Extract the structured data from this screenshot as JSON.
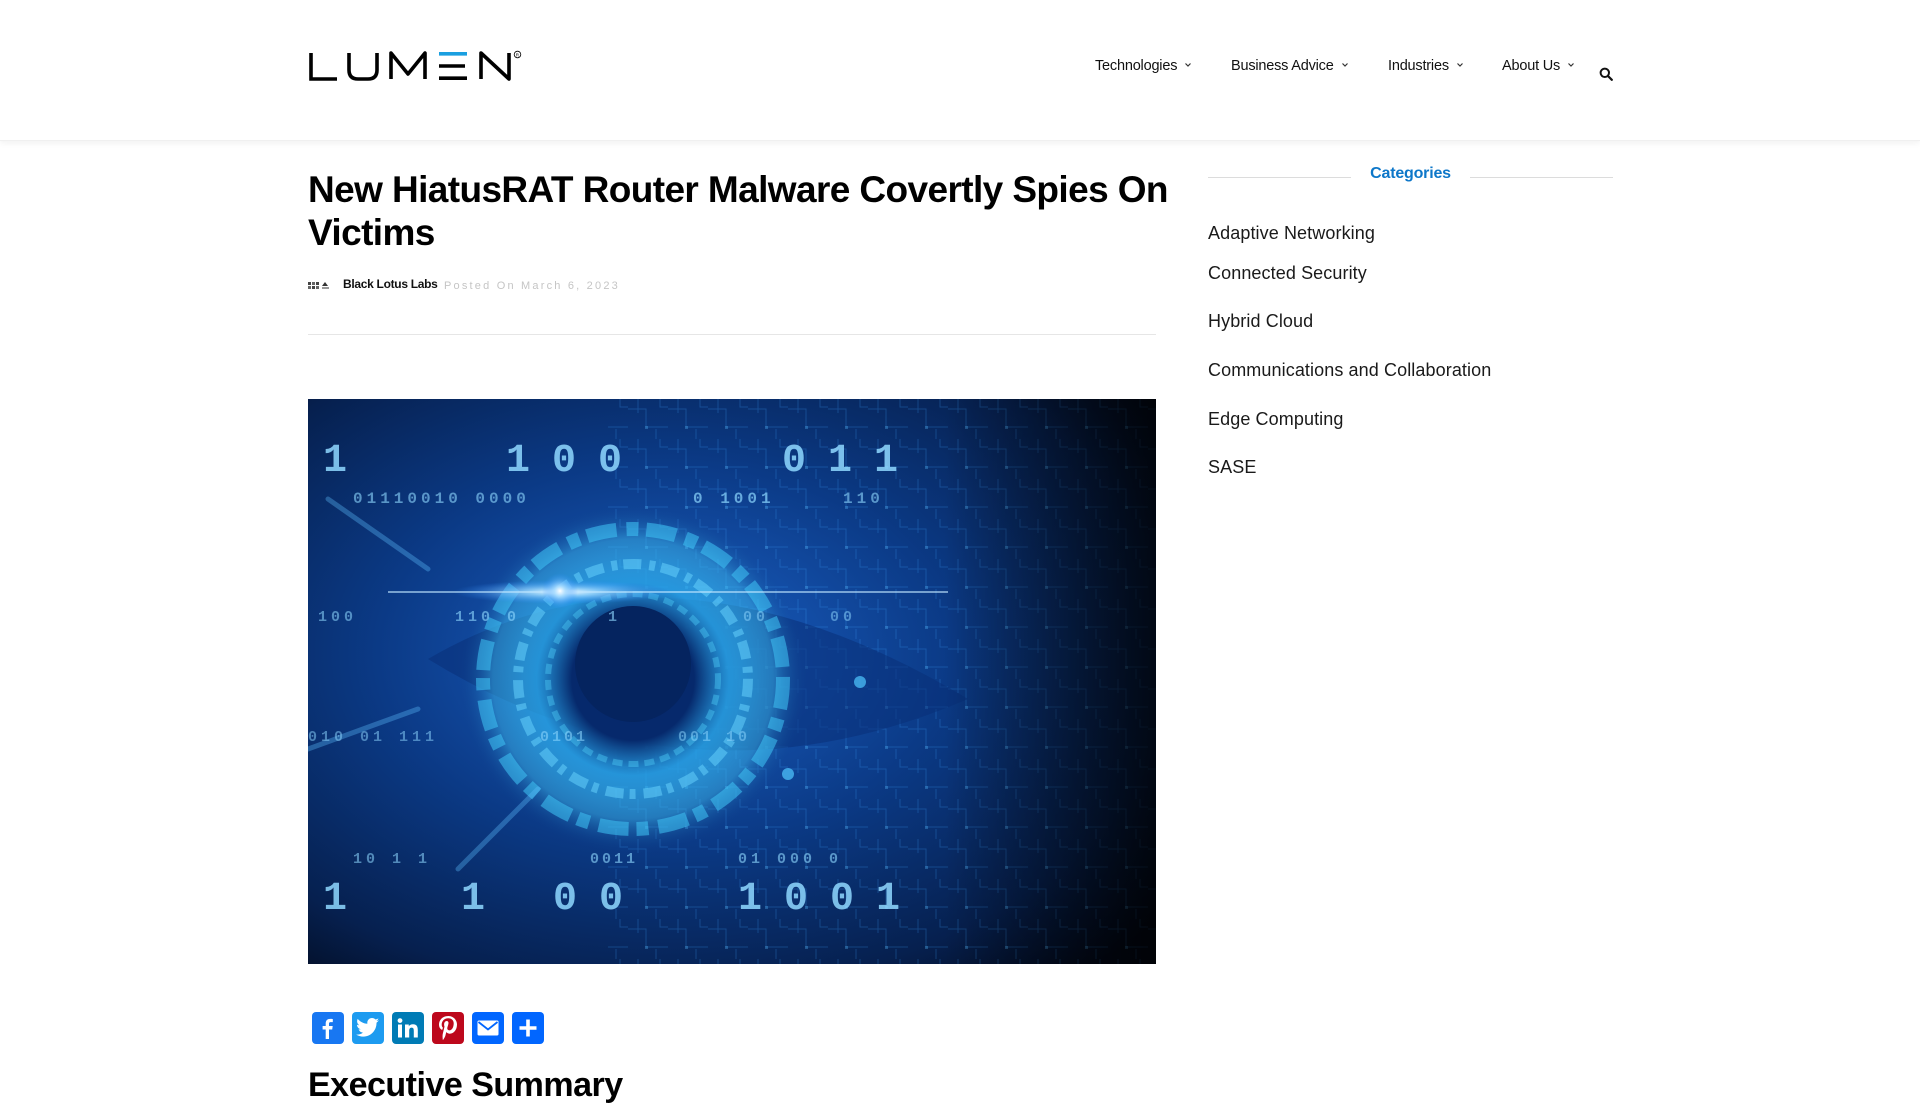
{
  "header": {
    "logo": {
      "text": "LUMEN",
      "registered": "®",
      "accent_color": "#1a9fe0"
    },
    "nav": [
      {
        "label": "Technologies",
        "icon": "chevron-down-icon"
      },
      {
        "label": "Business Advice",
        "icon": "chevron-down-icon"
      },
      {
        "label": "Industries",
        "icon": "chevron-down-icon"
      },
      {
        "label": "About Us",
        "icon": "chevron-down-icon"
      }
    ],
    "search_icon": "search-icon"
  },
  "article": {
    "title": "New HiatusRAT Router Malware Covertly Spies On Victims",
    "author": "Black Lotus Labs",
    "posted": "Posted On March 6, 2023",
    "hero_image": {
      "description": "Digital eye made of circuitry with binary code overlay",
      "binary_rows": [
        {
          "row": "top-large",
          "items": [
            "1",
            "1 0 0",
            "0 1 1"
          ]
        },
        {
          "row": "top-small",
          "items": [
            "01110010",
            "0000",
            "0 1001",
            "110"
          ]
        },
        {
          "row": "mid",
          "items": [
            "100",
            "110 0",
            "1",
            "00",
            "00"
          ]
        },
        {
          "row": "mid-low",
          "items": [
            "010",
            "01",
            "111",
            "0101",
            "001",
            "10"
          ]
        },
        {
          "row": "bottom-small",
          "items": [
            "10",
            "1",
            "1",
            "0011",
            "01",
            "000",
            "0"
          ]
        },
        {
          "row": "bottom-large",
          "items": [
            "1",
            "1",
            "0 0",
            "1 0 0 1"
          ]
        }
      ]
    },
    "share": [
      {
        "name": "facebook",
        "color": "#1877f2"
      },
      {
        "name": "twitter",
        "color": "#1d9bf0"
      },
      {
        "name": "linkedin",
        "color": "#007bb5"
      },
      {
        "name": "pinterest",
        "color": "#bd081c"
      },
      {
        "name": "email",
        "color": "#0166ff"
      },
      {
        "name": "share",
        "color": "#0166ff"
      }
    ],
    "next_heading": "Executive Summary"
  },
  "sidebar": {
    "title": "Categories",
    "title_color": "#0d77c9",
    "categories": [
      "Adaptive Networking",
      "Connected Security",
      "Hybrid Cloud",
      "Communications and Collaboration",
      "Edge Computing",
      "SASE"
    ]
  }
}
